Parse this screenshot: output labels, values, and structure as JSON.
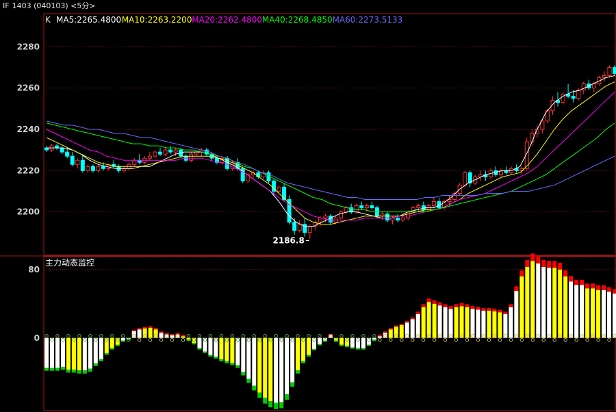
{
  "window": {
    "contract": "IF",
    "title": "1403 (040103) <5分>"
  },
  "colors": {
    "up": "#ff3232",
    "down": "#00ffff",
    "grid": "#7a1010",
    "panel_border": "#a01818",
    "axis_text": "#d0d0d0",
    "ma5": "#ffffff",
    "ma10": "#ffff00",
    "ma20": "#ff00ff",
    "ma40": "#00ff00",
    "ma60": "#6a6aff",
    "flow_white": "#ffffff",
    "flow_yellow": "#ffff00",
    "flow_red": "#ff0000",
    "flow_green": "#00cc00"
  },
  "chart_data": [
    {
      "type": "candlestick",
      "label": "K",
      "ma_legend": [
        {
          "name": "MA5",
          "value": "2265.4800",
          "color_key": "ma5"
        },
        {
          "name": "MA10",
          "value": "2263.2200",
          "color_key": "ma10"
        },
        {
          "name": "MA20",
          "value": "2262.4800",
          "color_key": "ma20"
        },
        {
          "name": "MA40",
          "value": "2268.4850",
          "color_key": "ma40"
        },
        {
          "name": "MA60",
          "value": "2273.5133",
          "color_key": "ma60"
        }
      ],
      "yticks": [
        2200,
        2220,
        2240,
        2260,
        2280
      ],
      "ylim": [
        2179,
        2296
      ],
      "grid": true,
      "min_annotation": {
        "text": "2186.8",
        "value": 2186.8
      },
      "candles": [
        [
          2231,
          2232,
          2229,
          2230
        ],
        [
          2230,
          2233,
          2229,
          2232
        ],
        [
          2232,
          2233,
          2230,
          2231
        ],
        [
          2231,
          2232,
          2228,
          2229
        ],
        [
          2229,
          2231,
          2226,
          2227
        ],
        [
          2227,
          2229,
          2222,
          2223
        ],
        [
          2223,
          2226,
          2221,
          2225
        ],
        [
          2225,
          2228,
          2219,
          2220
        ],
        [
          2220,
          2223,
          2219,
          2222
        ],
        [
          2222,
          2223,
          2219,
          2220
        ],
        [
          2220,
          2223,
          2219,
          2222
        ],
        [
          2222,
          2224,
          2220,
          2221
        ],
        [
          2221,
          2223,
          2220,
          2223
        ],
        [
          2223,
          2225,
          2221,
          2222
        ],
        [
          2222,
          2223,
          2219,
          2220
        ],
        [
          2220,
          2222,
          2219,
          2221
        ],
        [
          2221,
          2224,
          2220,
          2223
        ],
        [
          2223,
          2226,
          2222,
          2225
        ],
        [
          2225,
          2228,
          2223,
          2224
        ],
        [
          2224,
          2227,
          2223,
          2226
        ],
        [
          2226,
          2229,
          2225,
          2227
        ],
        [
          2227,
          2230,
          2226,
          2229
        ],
        [
          2229,
          2231,
          2227,
          2228
        ],
        [
          2228,
          2231,
          2227,
          2230
        ],
        [
          2230,
          2232,
          2228,
          2229
        ],
        [
          2229,
          2231,
          2227,
          2230
        ],
        [
          2230,
          2231,
          2226,
          2227
        ],
        [
          2227,
          2228,
          2224,
          2225
        ],
        [
          2225,
          2229,
          2224,
          2228
        ],
        [
          2228,
          2230,
          2227,
          2229
        ],
        [
          2229,
          2231,
          2227,
          2230
        ],
        [
          2230,
          2231,
          2227,
          2228
        ],
        [
          2228,
          2229,
          2225,
          2226
        ],
        [
          2226,
          2227,
          2223,
          2224
        ],
        [
          2224,
          2227,
          2223,
          2226
        ],
        [
          2226,
          2227,
          2220,
          2221
        ],
        [
          2221,
          2225,
          2220,
          2224
        ],
        [
          2224,
          2226,
          2220,
          2221
        ],
        [
          2221,
          2222,
          2214,
          2215
        ],
        [
          2215,
          2219,
          2214,
          2218
        ],
        [
          2218,
          2220,
          2216,
          2219
        ],
        [
          2219,
          2220,
          2216,
          2217
        ],
        [
          2217,
          2220,
          2216,
          2219
        ],
        [
          2219,
          2220,
          2214,
          2215
        ],
        [
          2215,
          2216,
          2208,
          2210
        ],
        [
          2210,
          2213,
          2209,
          2212
        ],
        [
          2212,
          2214,
          2205,
          2206
        ],
        [
          2206,
          2208,
          2194,
          2195
        ],
        [
          2195,
          2197,
          2189,
          2191
        ],
        [
          2191,
          2196,
          2190,
          2194
        ],
        [
          2194,
          2197,
          2188,
          2190
        ],
        [
          2190,
          2194,
          2186.8,
          2193
        ],
        [
          2193,
          2196,
          2191,
          2195
        ],
        [
          2195,
          2198,
          2193,
          2197
        ],
        [
          2197,
          2199,
          2195,
          2198
        ],
        [
          2198,
          2199,
          2194,
          2195
        ],
        [
          2195,
          2198,
          2194,
          2197
        ],
        [
          2197,
          2201,
          2196,
          2200
        ],
        [
          2200,
          2203,
          2199,
          2202
        ],
        [
          2202,
          2204,
          2199,
          2200
        ],
        [
          2200,
          2204,
          2199,
          2203
        ],
        [
          2203,
          2205,
          2201,
          2202
        ],
        [
          2202,
          2204,
          2200,
          2203
        ],
        [
          2203,
          2205,
          2201,
          2202
        ],
        [
          2202,
          2203,
          2197,
          2198
        ],
        [
          2198,
          2200,
          2196,
          2199
        ],
        [
          2199,
          2200,
          2195,
          2196
        ],
        [
          2196,
          2198,
          2194,
          2197
        ],
        [
          2197,
          2199,
          2195,
          2196
        ],
        [
          2196,
          2198,
          2195,
          2197
        ],
        [
          2197,
          2201,
          2196,
          2200
        ],
        [
          2200,
          2203,
          2199,
          2202
        ],
        [
          2202,
          2204,
          2200,
          2203
        ],
        [
          2203,
          2205,
          2200,
          2201
        ],
        [
          2201,
          2204,
          2200,
          2203
        ],
        [
          2203,
          2207,
          2202,
          2205
        ],
        [
          2205,
          2207,
          2201,
          2202
        ],
        [
          2202,
          2206,
          2201,
          2205
        ],
        [
          2205,
          2208,
          2203,
          2206
        ],
        [
          2206,
          2210,
          2205,
          2209
        ],
        [
          2209,
          2214,
          2208,
          2213
        ],
        [
          2213,
          2220,
          2212,
          2219
        ],
        [
          2219,
          2220,
          2212,
          2214
        ],
        [
          2214,
          2218,
          2213,
          2217
        ],
        [
          2217,
          2220,
          2215,
          2218
        ],
        [
          2218,
          2220,
          2215,
          2217
        ],
        [
          2217,
          2221,
          2216,
          2220
        ],
        [
          2220,
          2222,
          2217,
          2218
        ],
        [
          2218,
          2221,
          2217,
          2220
        ],
        [
          2220,
          2222,
          2218,
          2219
        ],
        [
          2219,
          2222,
          2218,
          2221
        ],
        [
          2221,
          2223,
          2219,
          2220
        ],
        [
          2220,
          2222,
          2218,
          2221
        ],
        [
          2221,
          2236,
          2220,
          2234
        ],
        [
          2234,
          2240,
          2232,
          2238
        ],
        [
          2238,
          2242,
          2236,
          2240
        ],
        [
          2240,
          2245,
          2238,
          2244
        ],
        [
          2244,
          2250,
          2243,
          2249
        ],
        [
          2249,
          2256,
          2247,
          2254
        ],
        [
          2254,
          2258,
          2251,
          2253
        ],
        [
          2253,
          2258,
          2252,
          2257
        ],
        [
          2257,
          2262,
          2255,
          2256
        ],
        [
          2256,
          2259,
          2253,
          2255
        ],
        [
          2255,
          2260,
          2254,
          2259
        ],
        [
          2259,
          2263,
          2257,
          2262
        ],
        [
          2262,
          2264,
          2259,
          2260
        ],
        [
          2260,
          2263,
          2258,
          2262
        ],
        [
          2262,
          2266,
          2261,
          2265
        ],
        [
          2265,
          2268,
          2263,
          2266
        ],
        [
          2266,
          2271,
          2265,
          2270
        ],
        [
          2270,
          2271,
          2266,
          2267
        ]
      ],
      "ma_lines": {
        "ma5": [
          2231,
          2231,
          2231,
          2230,
          2228,
          2225,
          2223,
          2222,
          2221,
          2221,
          2221,
          2222,
          2222,
          2224,
          2226,
          2228,
          2229,
          2229,
          2229,
          2228,
          2226,
          2224,
          2222,
          2219,
          2216,
          2213,
          2210,
          2205,
          2199,
          2195,
          2193,
          2193,
          2195,
          2197,
          2199,
          2200,
          2200,
          2199,
          2198,
          2197,
          2197,
          2198,
          2200,
          2201,
          2202,
          2202,
          2204,
          2207,
          2211,
          2214,
          2216,
          2218,
          2219,
          2220,
          2220,
          2222,
          2230,
          2240,
          2248,
          2253,
          2256,
          2258,
          2259,
          2261,
          2263,
          2265,
          2266
        ],
        "ma10": [
          2236,
          2234,
          2232,
          2230,
          2228,
          2226,
          2224,
          2223,
          2222,
          2222,
          2222,
          2222,
          2223,
          2224,
          2225,
          2226,
          2227,
          2227,
          2227,
          2227,
          2226,
          2225,
          2223,
          2221,
          2219,
          2216,
          2213,
          2209,
          2205,
          2201,
          2197,
          2195,
          2194,
          2194,
          2195,
          2196,
          2197,
          2198,
          2198,
          2198,
          2198,
          2198,
          2199,
          2200,
          2201,
          2201,
          2202,
          2204,
          2206,
          2209,
          2211,
          2213,
          2215,
          2217,
          2218,
          2219,
          2223,
          2228,
          2234,
          2240,
          2245,
          2249,
          2252,
          2255,
          2258,
          2261,
          2263
        ],
        "ma20": [
          2240,
          2238,
          2236,
          2234,
          2232,
          2230,
          2229,
          2227,
          2226,
          2225,
          2225,
          2225,
          2225,
          2225,
          2225,
          2225,
          2226,
          2226,
          2226,
          2225,
          2224,
          2223,
          2221,
          2219,
          2216,
          2213,
          2210,
          2207,
          2204,
          2202,
          2200,
          2198,
          2197,
          2196,
          2196,
          2196,
          2196,
          2197,
          2197,
          2197,
          2197,
          2198,
          2198,
          2199,
          2200,
          2201,
          2202,
          2204,
          2206,
          2207,
          2208,
          2209,
          2211,
          2213,
          2215,
          2217,
          2219,
          2222,
          2226,
          2230,
          2234,
          2238,
          2242,
          2246,
          2250,
          2254,
          2258
        ],
        "ma40": [
          2243,
          2242,
          2241,
          2240,
          2239,
          2238,
          2237,
          2236,
          2235,
          2234,
          2233,
          2233,
          2232,
          2232,
          2231,
          2231,
          2230,
          2230,
          2229,
          2228,
          2227,
          2226,
          2224,
          2222,
          2221,
          2219,
          2217,
          2215,
          2213,
          2211,
          2209,
          2207,
          2206,
          2204,
          2203,
          2202,
          2201,
          2201,
          2200,
          2200,
          2200,
          2200,
          2200,
          2200,
          2200,
          2201,
          2202,
          2203,
          2204,
          2205,
          2206,
          2207,
          2208,
          2209,
          2210,
          2212,
          2214,
          2216,
          2218,
          2221,
          2224,
          2227,
          2230,
          2233,
          2236,
          2240,
          2243
        ],
        "ma60": [
          2244,
          2243,
          2242,
          2242,
          2241,
          2240,
          2240,
          2239,
          2238,
          2238,
          2237,
          2236,
          2236,
          2235,
          2234,
          2233,
          2232,
          2231,
          2230,
          2229,
          2227,
          2226,
          2224,
          2223,
          2221,
          2219,
          2218,
          2216,
          2214,
          2213,
          2212,
          2211,
          2210,
          2209,
          2208,
          2207,
          2207,
          2206,
          2206,
          2206,
          2206,
          2206,
          2206,
          2206,
          2207,
          2207,
          2208,
          2208,
          2208,
          2208,
          2208,
          2209,
          2209,
          2209,
          2210,
          2210,
          2210,
          2211,
          2212,
          2213,
          2215,
          2217,
          2219,
          2221,
          2223,
          2225,
          2227
        ]
      }
    },
    {
      "type": "bar",
      "title": "主力动态监控",
      "yticks": [
        0,
        80
      ],
      "ylim": [
        -85,
        95
      ],
      "grid": true,
      "values": [
        -35,
        -35,
        -35,
        -34,
        -37,
        -37,
        -38,
        -38,
        -36,
        -30,
        -25,
        -18,
        -12,
        -8,
        -3,
        -1,
        8,
        10,
        11,
        12,
        10,
        6,
        4,
        3,
        4,
        2,
        -2,
        -6,
        -12,
        -16,
        -20,
        -22,
        -25,
        -27,
        -29,
        -32,
        -40,
        -48,
        -56,
        -64,
        -70,
        -74,
        -76,
        -75,
        -66,
        -52,
        -38,
        -27,
        -20,
        -13,
        -7,
        -3,
        3,
        -3,
        -8,
        -9,
        -11,
        -12,
        -12,
        -8,
        -2,
        2,
        6,
        10,
        13,
        15,
        18,
        22,
        28,
        36,
        42,
        40,
        38,
        36,
        34,
        36,
        37,
        36,
        34,
        33,
        32,
        32,
        31,
        30,
        28,
        36,
        55,
        72,
        83,
        90,
        87,
        83,
        82,
        82,
        80,
        72,
        66,
        62,
        62,
        58,
        58,
        56,
        56,
        54,
        52
      ],
      "yellow_from_index": 60
    }
  ]
}
